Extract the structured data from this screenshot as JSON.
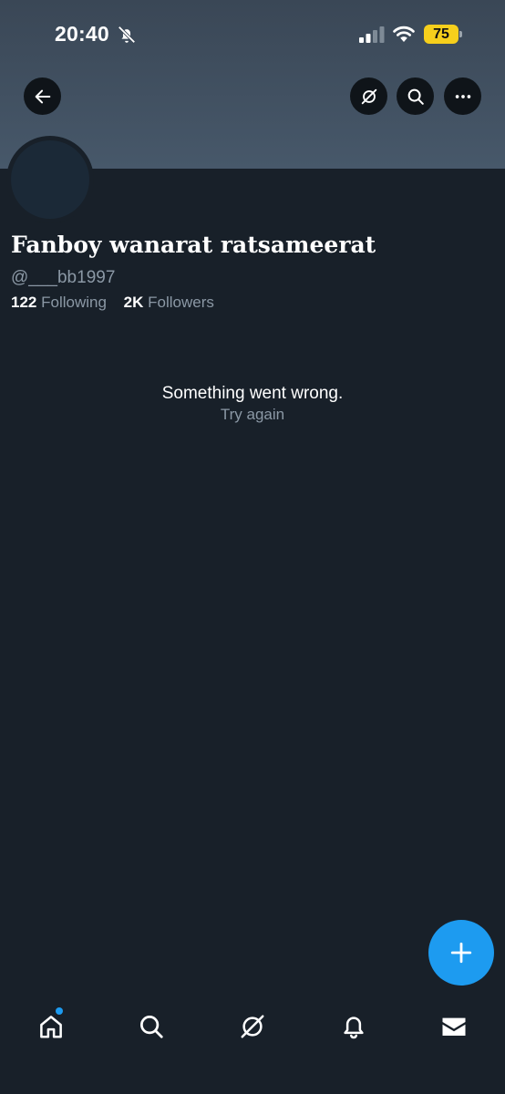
{
  "status_bar": {
    "time": "20:40",
    "battery_level": "75",
    "signal_bars": 2,
    "icons": [
      "bell-off-icon",
      "cellular-signal-icon",
      "wifi-icon",
      "battery-icon"
    ]
  },
  "colors": {
    "background": "#182029",
    "banner": "#47586a",
    "accent": "#1d9bf0",
    "battery": "#f6cf1c",
    "secondary_text": "#8b98a5"
  },
  "header": {
    "buttons": [
      "back-arrow-icon",
      "grok-icon",
      "search-icon",
      "more-icon"
    ]
  },
  "profile": {
    "display_name": "Fanboy wanarat ratsameerat",
    "handle": "@___bb1997",
    "following_count": "122",
    "following_label": "Following",
    "followers_count": "2K",
    "followers_label": "Followers"
  },
  "error": {
    "message": "Something went wrong.",
    "retry_label": "Try again"
  },
  "fab": {
    "icon": "plus-icon"
  },
  "bottom_nav": {
    "items": [
      "home-icon",
      "search-icon",
      "grok-icon",
      "notifications-icon",
      "messages-icon"
    ],
    "home_has_unread": true
  }
}
